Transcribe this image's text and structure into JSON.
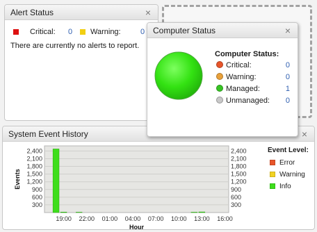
{
  "alert_status": {
    "title": "Alert Status",
    "critical_label": "Critical:",
    "critical_count": "0",
    "warning_label": "Warning:",
    "warning_count": "0",
    "message": "There are currently no alerts to report.",
    "close": "×"
  },
  "computer_status": {
    "title": "Computer Status",
    "heading": "Computer Status:",
    "close": "×",
    "rows": [
      {
        "label": "Critical:",
        "value": "0",
        "color": "#e8552a"
      },
      {
        "label": "Warning:",
        "value": "0",
        "color": "#e9a13a"
      },
      {
        "label": "Managed:",
        "value": "1",
        "color": "#37c424"
      },
      {
        "label": "Unmanaged:",
        "value": "0",
        "color": "#c9c9c9"
      }
    ]
  },
  "event_history": {
    "title": "System Event History",
    "close": "×",
    "legend_title": "Event Level:",
    "legend": [
      {
        "label": "Error",
        "color": "#e8552a"
      },
      {
        "label": "Warning",
        "color": "#f2d222"
      },
      {
        "label": "Info",
        "color": "#3ede1c"
      }
    ]
  },
  "colors": {
    "critical": "#dd1111",
    "warning": "#f2cf12",
    "info": "#3ede1c",
    "link_blue": "#2f5fb0",
    "chart_bg": "#e6e6e3"
  },
  "chart_data": {
    "type": "bar",
    "title": "",
    "xlabel": "Hour",
    "ylabel": "Events",
    "ylim": [
      0,
      2600
    ],
    "yticks": [
      300,
      600,
      900,
      1200,
      1500,
      1800,
      2100,
      2400
    ],
    "ytick_labels": [
      "300",
      "600",
      "900",
      "1,200",
      "1,500",
      "1,800",
      "2,100",
      "2,400"
    ],
    "xticks": [
      "19:00",
      "22:00",
      "01:00",
      "04:00",
      "07:00",
      "10:00",
      "13:00",
      "16:00"
    ],
    "grid": true,
    "legend_position": "right",
    "series": [
      {
        "name": "Info",
        "color": "#3ede1c",
        "values": [
          {
            "hour": "18:00",
            "value": 2480
          },
          {
            "hour": "19:00",
            "value": 20
          },
          {
            "hour": "21:00",
            "value": 15
          },
          {
            "hour": "12:00",
            "value": 15
          },
          {
            "hour": "13:00",
            "value": 25
          }
        ]
      }
    ]
  }
}
